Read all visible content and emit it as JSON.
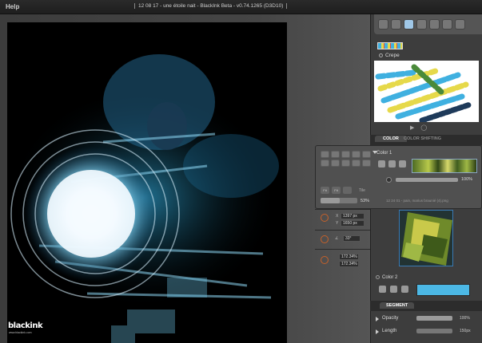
{
  "titlebar": {
    "menu_help": "Help",
    "title": "12 08 17 - une étoile nait - BlackInk Beta - v0.74.1265 (D3D10)"
  },
  "tools": [
    "pen-tool",
    "brush-1",
    "brush-2",
    "brush-3",
    "brush-4",
    "eraser-tool",
    "smudge-tool"
  ],
  "brush": {
    "name": "Crepe",
    "preview_controls": [
      "play-icon",
      "settings-icon"
    ]
  },
  "tabs": {
    "color": "COLOR",
    "color_shifting": "COLOR SHIFTING"
  },
  "color1": {
    "label": "Color 1",
    "opacity": "100%",
    "opacity_fraction": 1.0,
    "tile_label": "Tile",
    "secondary_pct": "53%",
    "secondary_fraction": 0.53,
    "file_label": "12 24 01 - pain, marius braunié (4).png",
    "buttons": [
      "Fit",
      "Fit"
    ]
  },
  "transform": {
    "position_x": "1397 px",
    "position_y": "1650 px",
    "x_label": "X",
    "y_label": "Y",
    "rotation": "33°",
    "scale_x": "172.34%",
    "scale_y": "172.34%"
  },
  "color2": {
    "label": "Color 2",
    "swatch_color": "#4cb8e5"
  },
  "segment": {
    "tab": "SEGMENT",
    "opacity_label": "Opacity",
    "opacity_value": "100%",
    "opacity_fraction": 1.0,
    "length_label": "Length",
    "length_value": "150px"
  },
  "logo": {
    "text": "blackink",
    "sub": "www.blackink.com"
  },
  "colors": {
    "accent": "#4cb8e5",
    "icon_orange": "#c6612a",
    "panel": "#3d3d3d"
  }
}
